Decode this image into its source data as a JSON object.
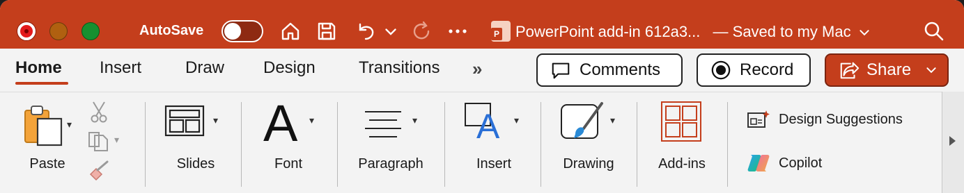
{
  "titlebar": {
    "autosave_label": "AutoSave",
    "autosave_on": false,
    "document_title": "PowerPoint add-in 612a3...",
    "save_status": "— Saved to my Mac",
    "app_badge_letter": "P",
    "accent_color": "#c43e1c"
  },
  "tabs": [
    {
      "label": "Home",
      "active": true
    },
    {
      "label": "Insert",
      "active": false
    },
    {
      "label": "Draw",
      "active": false
    },
    {
      "label": "Design",
      "active": false
    },
    {
      "label": "Transitions",
      "active": false
    }
  ],
  "more_tabs_label": "»",
  "actions": {
    "comments_label": "Comments",
    "record_label": "Record",
    "share_label": "Share"
  },
  "groups": {
    "paste": "Paste",
    "slides": "Slides",
    "font": "Font",
    "font_glyph": "A",
    "paragraph": "Paragraph",
    "insert": "Insert",
    "insert_glyph": "A",
    "drawing": "Drawing",
    "addins": "Add-ins",
    "design_suggestions": "Design Suggestions",
    "copilot": "Copilot"
  }
}
